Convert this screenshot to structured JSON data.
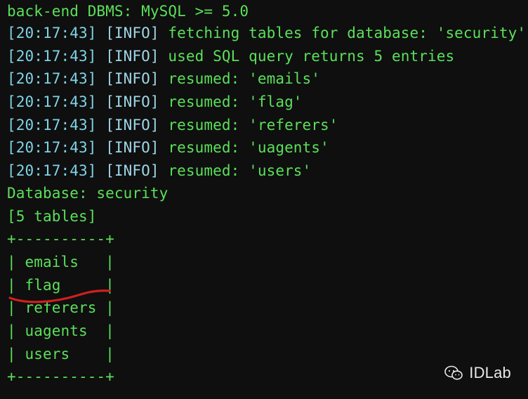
{
  "terminal": {
    "header_line": "back-end DBMS: MySQL >= 5.0",
    "log": [
      {
        "time": "[20:17:43]",
        "level": "[INFO]",
        "message": "fetching tables for database: 'security'"
      },
      {
        "time": "[20:17:43]",
        "level": "[INFO]",
        "message": "used SQL query returns 5 entries"
      },
      {
        "time": "[20:17:43]",
        "level": "[INFO]",
        "message": "resumed: 'emails'"
      },
      {
        "time": "[20:17:43]",
        "level": "[INFO]",
        "message": "resumed: 'flag'"
      },
      {
        "time": "[20:17:43]",
        "level": "[INFO]",
        "message": "resumed: 'referers'"
      },
      {
        "time": "[20:17:43]",
        "level": "[INFO]",
        "message": "resumed: 'uagents'"
      },
      {
        "time": "[20:17:43]",
        "level": "[INFO]",
        "message": "resumed: 'users'"
      }
    ],
    "database_line": "Database: security",
    "tables_count_line": "[5 tables]",
    "table_border": "+----------+",
    "table_rows": [
      "| emails   |",
      "| flag     |",
      "| referers |",
      "| uagents  |",
      "| users    |"
    ]
  },
  "watermark": {
    "text": "IDLab",
    "icon": "wechat-icon"
  },
  "colors": {
    "background": "#0f0f0f",
    "text_green": "#5be05a",
    "timestamp_cyan": "#7fd3e6",
    "annotation_red": "#d21e1e"
  }
}
